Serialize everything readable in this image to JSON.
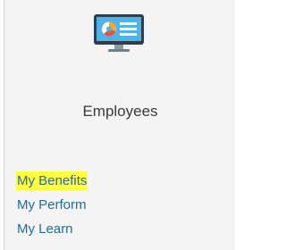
{
  "tile": {
    "icon": "monitor-chart-icon",
    "title": "Employees"
  },
  "links": [
    {
      "label": "My Benefits",
      "highlighted": true,
      "highlight_color": "#ffff3c"
    },
    {
      "label": "My Perform",
      "highlighted": false
    },
    {
      "label": "My Learn",
      "highlighted": false
    }
  ],
  "colors": {
    "link": "#1f6aa5",
    "title": "#3a3a3a",
    "tile_background": "#f4f4f4"
  }
}
